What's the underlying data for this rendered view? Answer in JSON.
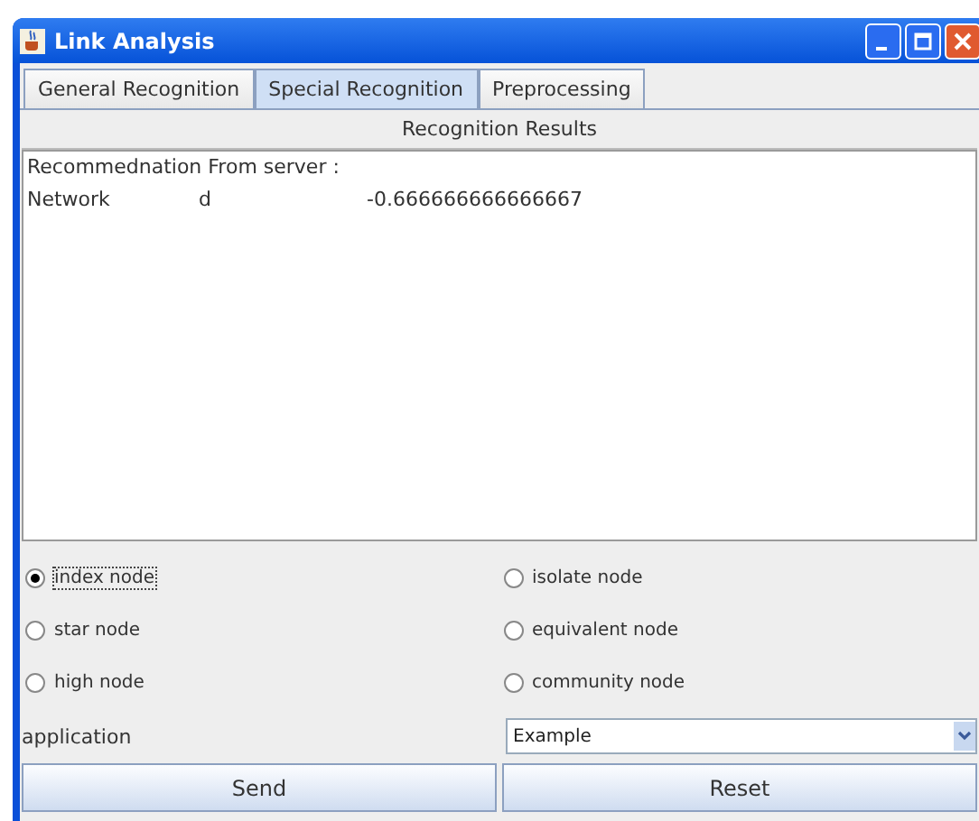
{
  "window": {
    "title": "Link Analysis"
  },
  "tabs": [
    {
      "label": "General Recognition",
      "selected": false
    },
    {
      "label": "Special Recognition",
      "selected": true
    },
    {
      "label": "Preprocessing",
      "selected": false
    }
  ],
  "results": {
    "header": "Recognition Results",
    "heading": "Recommednation From server :",
    "rows": [
      [
        "Network",
        "d",
        "-0.666666666666667"
      ]
    ]
  },
  "options": [
    {
      "label": "index node",
      "selected": true
    },
    {
      "label": "isolate node",
      "selected": false
    },
    {
      "label": "star node",
      "selected": false
    },
    {
      "label": "equivalent node",
      "selected": false
    },
    {
      "label": "high node",
      "selected": false
    },
    {
      "label": "community node",
      "selected": false
    }
  ],
  "application": {
    "label": "application",
    "value": "Example"
  },
  "buttons": [
    "Send",
    "Reset"
  ]
}
